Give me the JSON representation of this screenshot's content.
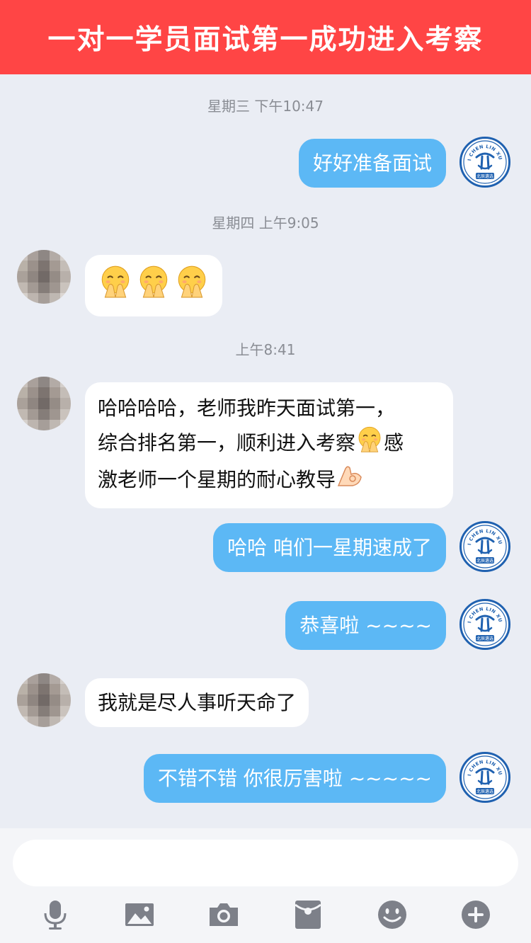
{
  "banner": {
    "title": "一对一学员面试第一成功进入考察"
  },
  "timestamps": [
    "星期三 下午10:47",
    "星期四 上午9:05",
    "上午8:41"
  ],
  "messages": [
    {
      "from": "me",
      "text": "好好准备面试"
    },
    {
      "from": "peer",
      "emojis": [
        "shush-face-emoji",
        "shush-face-emoji",
        "shush-face-emoji"
      ]
    },
    {
      "from": "peer",
      "lines": [
        "哈哈哈哈，老师我昨天面试第一，",
        "综合排名第一，顺利进入考察",
        "感",
        "激老师一个星期的耐心教导"
      ]
    },
    {
      "from": "me",
      "text": "哈哈 咱们一星期速成了"
    },
    {
      "from": "me",
      "text": "恭喜啦 ~~~~"
    },
    {
      "from": "peer",
      "text": "我就是尽人事听天命了"
    },
    {
      "from": "me",
      "text": "不错不错 你很厉害啦 ~~~~~"
    }
  ],
  "avatar_logo": {
    "text": "BEI CHEN LIN XUAN",
    "subtext": "北辰遴选",
    "color": "#1f61b0"
  },
  "composer": {
    "input_value": "",
    "toolbar": [
      "microphone-icon",
      "image-icon",
      "camera-icon",
      "red-packet-icon",
      "smiley-icon",
      "plus-icon"
    ]
  },
  "colors": {
    "banner": "#ff4545",
    "outgoing_bubble": "#5cb8f5",
    "background": "#eaedf4"
  }
}
